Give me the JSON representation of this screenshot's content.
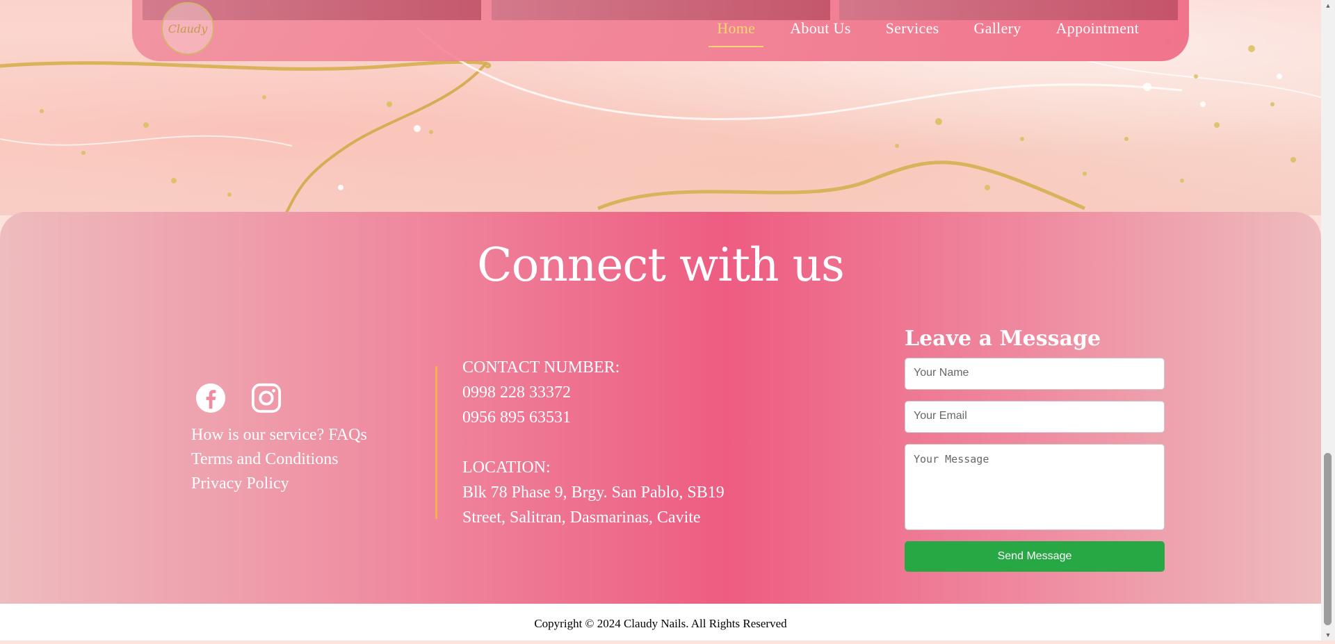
{
  "nav": {
    "logo_text": "Claudy",
    "items": [
      {
        "label": "Home",
        "active": true
      },
      {
        "label": "About Us",
        "active": false
      },
      {
        "label": "Services",
        "active": false
      },
      {
        "label": "Gallery",
        "active": false
      },
      {
        "label": "Appointment",
        "active": false
      }
    ]
  },
  "connect": {
    "title": "Connect with us",
    "social": [
      "facebook-icon",
      "instagram-icon"
    ],
    "links": [
      "How is our service? FAQs",
      "Terms and Conditions",
      "Privacy Policy"
    ],
    "contact_label": "CONTACT NUMBER:",
    "phones": [
      "0998 228 33372",
      "0956 895 63531"
    ],
    "location_label": "LOCATION:",
    "address_lines": [
      "Blk 78 Phase 9, Brgy. San Pablo, SB19",
      "Street, Salitran, Dasmarinas, Cavite"
    ]
  },
  "form": {
    "title": "Leave a Message",
    "name_placeholder": "Your Name",
    "email_placeholder": "Your Email",
    "message_placeholder": "Your Message",
    "send_label": "Send Message"
  },
  "footer": {
    "copyright": "Copyright © 2024 Claudy Nails. All Rights Reserved"
  },
  "colors": {
    "accent_gold": "#f7d774",
    "send_green": "#28a745",
    "divider": "#f2b24a"
  }
}
